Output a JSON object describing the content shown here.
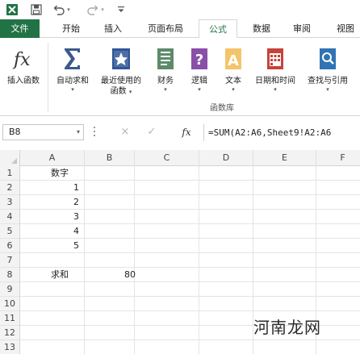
{
  "quick_access": {
    "save_icon": "save-icon",
    "undo_icon": "undo-icon",
    "redo_icon": "redo-icon",
    "customize_icon": "customize-caret-icon"
  },
  "tabs": [
    {
      "label": "文件"
    },
    {
      "label": "开始"
    },
    {
      "label": "插入"
    },
    {
      "label": "页面布局"
    },
    {
      "label": "公式"
    },
    {
      "label": "数据"
    },
    {
      "label": "审阅"
    },
    {
      "label": "视图"
    }
  ],
  "ribbon": {
    "buttons": [
      {
        "label": "插入函数",
        "icon": "insert-function-icon"
      },
      {
        "label": "自动求和",
        "icon": "autosum-icon"
      },
      {
        "label": "最近使用的",
        "label2": "函数",
        "icon": "recent-functions-icon"
      },
      {
        "label": "财务",
        "icon": "financial-icon"
      },
      {
        "label": "逻辑",
        "icon": "logical-icon"
      },
      {
        "label": "文本",
        "icon": "text-icon"
      },
      {
        "label": "日期和时间",
        "icon": "date-time-icon"
      },
      {
        "label": "查找与引用",
        "icon": "lookup-reference-icon"
      }
    ],
    "group_label": "函数库"
  },
  "formula_bar": {
    "name_box": "B8",
    "cancel_icon": "×",
    "enter_icon": "✓",
    "fx_label": "fx",
    "formula": "=SUM(A2:A6,Sheet9!A2:A6"
  },
  "columns": [
    "A",
    "B",
    "C",
    "D",
    "E",
    "F"
  ],
  "rows": [
    "1",
    "2",
    "3",
    "4",
    "5",
    "6",
    "7",
    "8",
    "9",
    "10",
    "11",
    "12",
    "13"
  ],
  "cells": {
    "A1": "数字",
    "A2": "1",
    "A3": "2",
    "A4": "3",
    "A5": "4",
    "A6": "5",
    "A8": "求和",
    "B8": "80"
  },
  "watermark": "河南龙网",
  "colors": {
    "accent": "#217346",
    "autosum": "#3b5a8a",
    "financial": "#5e8a6a",
    "logical": "#8a4fa8",
    "text": "#e8a23a",
    "datetime": "#c8413b",
    "lookup": "#2f74b5"
  }
}
